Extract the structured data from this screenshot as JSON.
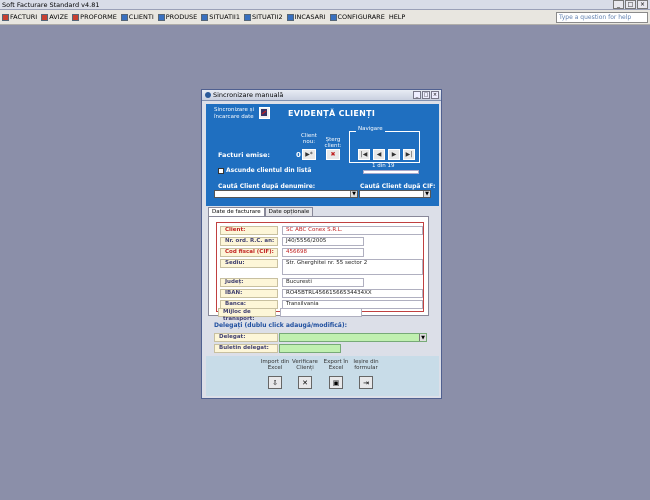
{
  "window": {
    "title": "Soft Facturare Standard v4.81"
  },
  "menu": [
    {
      "label": "FACTURI",
      "color": "red"
    },
    {
      "label": "AVIZE",
      "color": "red"
    },
    {
      "label": "PROFORME",
      "color": "red"
    },
    {
      "label": "CLIENTI",
      "color": "blue"
    },
    {
      "label": "PRODUSE",
      "color": "blue"
    },
    {
      "label": "SITUATII1",
      "color": "blue"
    },
    {
      "label": "SITUATII2",
      "color": "blue"
    },
    {
      "label": "INCASARI",
      "color": "blue"
    },
    {
      "label": "CONFIGURARE",
      "color": "blue"
    },
    {
      "label": "HELP",
      "color": "none"
    }
  ],
  "help_search": {
    "placeholder": "Type a question for help"
  },
  "dialog": {
    "title": "Sincronizare manuală",
    "sync_label": "Sincronizare și încarcare date",
    "heading": "EVIDENȚĂ CLIENȚI",
    "client_nou": "Client nou:",
    "sterg_client": "Șterg client:",
    "navigare": "Navigare",
    "facturi_label": "Facturi emise:",
    "facturi_value": "0",
    "position": "1 din 19",
    "ascunde": "Ascunde clientul din listă",
    "search_name": "Caută Client după denumire:",
    "search_cif": "Caută Client după CIF:",
    "tabs": [
      "Date de facturare",
      "Date opționale"
    ],
    "fields": [
      {
        "label": "Client:",
        "value": "SC ABC Conex S.R.L.",
        "red": true
      },
      {
        "label": "Nr. ord. R.C. an:",
        "value": "J40/5556/2005",
        "red": false
      },
      {
        "label": "Cod fiscal (CIF):",
        "value": "456698",
        "red": true
      },
      {
        "label": "Sediu:",
        "value": "Str. Gherghitei nr. 55 sector 2",
        "red": false
      },
      {
        "label": "Județ:",
        "value": "Bucuresti",
        "red": false
      },
      {
        "label": "IBAN:",
        "value": "RO45BTRL45661566534434XX",
        "red": false
      },
      {
        "label": "Banca:",
        "value": "Transilvania",
        "red": false
      },
      {
        "label": "Mijloc de transport:",
        "value": "",
        "red": false
      }
    ],
    "delegati_title": "Delegați (dublu click adaugă/modifică):",
    "delegat_label": "Delegat:",
    "buletin_label": "Buletin delegat:",
    "footer": [
      {
        "label": "Import din Excel",
        "icon": "import-icon"
      },
      {
        "label": "Verificare Clienți",
        "icon": "tools-icon"
      },
      {
        "label": "Export în Excel",
        "icon": "export-icon"
      },
      {
        "label": "Ieșire din formular",
        "icon": "exit-icon"
      }
    ]
  }
}
